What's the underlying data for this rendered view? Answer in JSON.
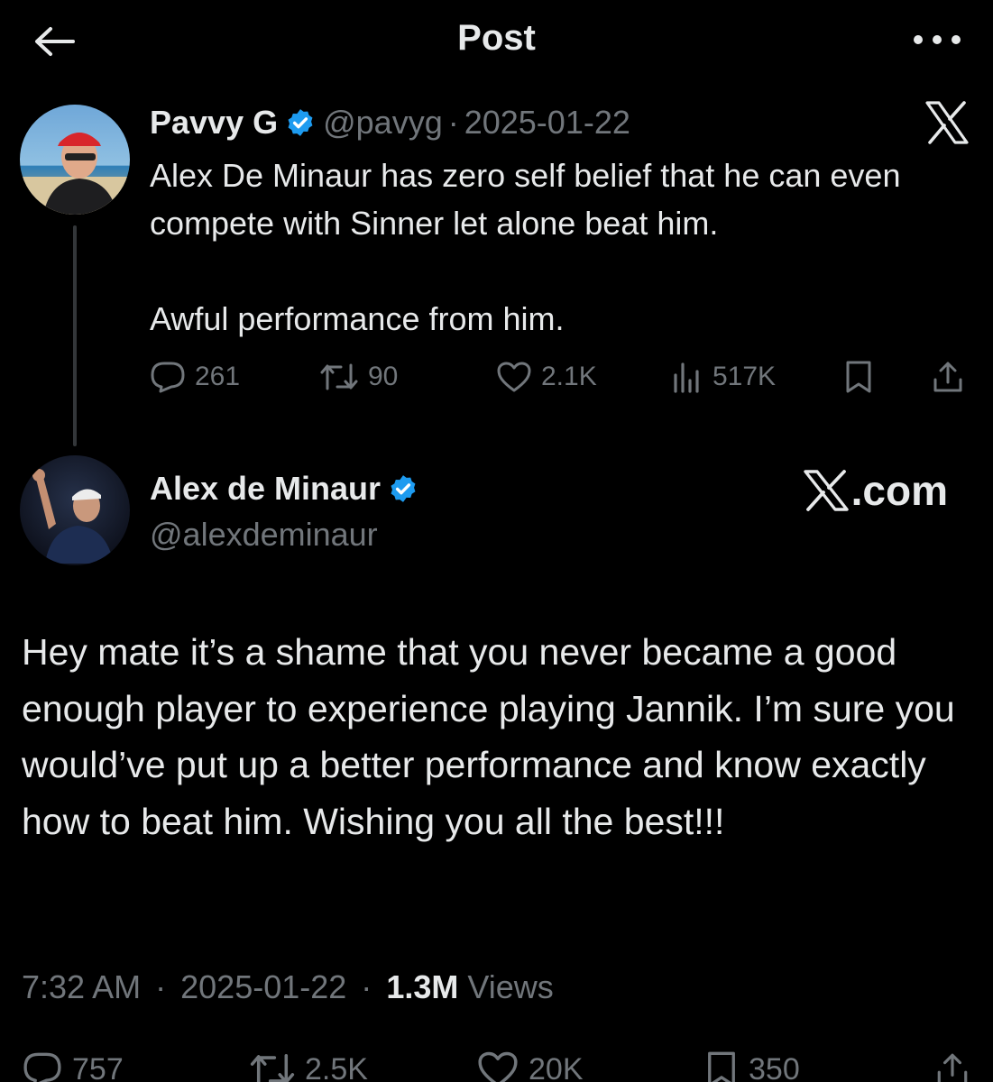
{
  "header": {
    "title": "Post"
  },
  "parent_tweet": {
    "display_name": "Pavvy G",
    "handle": "@pavyg",
    "separator": "·",
    "date": "2025-01-22",
    "text": "Alex De Minaur has zero self belief that he can even compete with Sinner let alone beat him.\n\nAwful performance from him.",
    "actions": {
      "replies": "261",
      "reposts": "90",
      "likes": "2.1K",
      "views": "517K"
    }
  },
  "reply_tweet": {
    "display_name": "Alex de Minaur",
    "handle": "@alexdeminaur",
    "source_label": ".com",
    "text": "Hey mate it’s a shame that you never became a good enough player to experience playing Jannik. I’m sure you would’ve put up a better performance and know exactly how to beat him. Wishing you all the best!!!",
    "meta": {
      "time": "7:32 AM",
      "separator": "·",
      "date": "2025-01-22",
      "views_count": "1.3M",
      "views_label": "Views"
    },
    "actions": {
      "replies": "757",
      "reposts": "2.5K",
      "likes": "20K",
      "bookmarks": "350"
    }
  },
  "icons": {
    "back": "arrow-left-icon",
    "more": "more-horizontal-icon",
    "verified": "verified-badge-icon",
    "brand": "x-logo-icon",
    "reply": "reply-icon",
    "repost": "repost-icon",
    "like": "heart-icon",
    "views": "views-icon",
    "bookmark": "bookmark-icon",
    "share": "share-icon"
  },
  "colors": {
    "background": "#000000",
    "text": "#e7e9ea",
    "muted": "#71767b",
    "verified": "#1d9bf0"
  }
}
